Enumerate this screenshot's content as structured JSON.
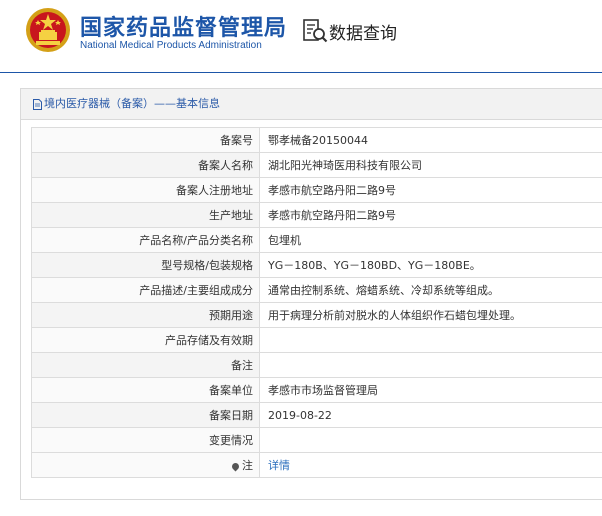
{
  "header": {
    "agency_cn": "国家药品监督管理局",
    "agency_en": "National Medical Products Administration",
    "query_label": "数据查询",
    "brand_color": "#1d56a8"
  },
  "panel": {
    "breadcrumb": "境内医疗器械（备案）——基本信息"
  },
  "record": [
    {
      "label": "备案号",
      "value": "鄂孝械备20150044"
    },
    {
      "label": "备案人名称",
      "value": "湖北阳光神琦医用科技有限公司"
    },
    {
      "label": "备案人注册地址",
      "value": "孝感市航空路丹阳二路9号"
    },
    {
      "label": "生产地址",
      "value": "孝感市航空路丹阳二路9号"
    },
    {
      "label": "产品名称/产品分类名称",
      "value": "包埋机"
    },
    {
      "label": "型号规格/包装规格",
      "value": "YG－180B、YG－180BD、YG－180BE。"
    },
    {
      "label": "产品描述/主要组成成分",
      "value": "通常由控制系统、熔蜡系统、冷却系统等组成。"
    },
    {
      "label": "预期用途",
      "value": "用于病理分析前对脱水的人体组织作石蜡包埋处理。"
    },
    {
      "label": "产品存储及有效期",
      "value": ""
    },
    {
      "label": "备注",
      "value": ""
    },
    {
      "label": "备案单位",
      "value": "孝感市市场监督管理局"
    },
    {
      "label": "备案日期",
      "value": "2019-08-22"
    },
    {
      "label": "变更情况",
      "value": ""
    }
  ],
  "note": {
    "label": "注",
    "link": "详情"
  }
}
